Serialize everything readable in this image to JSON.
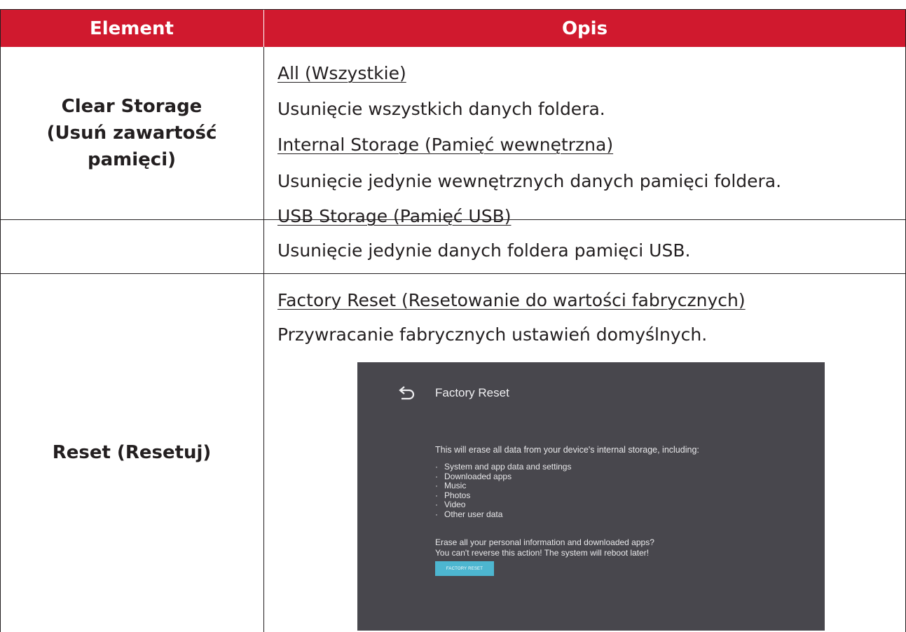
{
  "table": {
    "headers": {
      "element": "Element",
      "description": "Opis"
    },
    "rows": [
      {
        "element": "Clear Storage (Usuń zawartość pamięci)",
        "element_lines": [
          "Clear Storage",
          "(Usuń zawartość",
          "pamięci)"
        ],
        "items": [
          {
            "option": "All (Wszystkie)",
            "text": "Usunięcie wszystkich danych foldera."
          },
          {
            "option": "Internal Storage (Pamięć wewnętrzna)",
            "text": "Usunięcie jedynie wewnętrznych danych pamięci foldera."
          },
          {
            "option": "USB Storage (Pamięć USB)",
            "text": "Usunięcie jedynie danych foldera pamięci USB."
          }
        ]
      },
      {
        "element": "Reset (Resetuj)",
        "items": [
          {
            "option": "Factory Reset (Resetowanie do wartości fabrycznych)",
            "text": "Przywracanie fabrycznych ustawień domyślnych."
          }
        ]
      }
    ]
  },
  "screenshot": {
    "title": "Factory Reset",
    "intro": "This will erase all data from your device's internal storage, including:",
    "list": [
      "System and app data and settings",
      "Downloaded apps",
      "Music",
      "Photos",
      "Video",
      "Other user data"
    ],
    "warning_line1": "Erase all your personal information and downloaded apps?",
    "warning_line2": "You can't reverse this action! The system will reboot later!",
    "button": "FACTORY RESET",
    "back_icon": "back-arrow-icon",
    "colors": {
      "background": "#48474d",
      "button": "#4db6d0"
    }
  },
  "colors": {
    "header": "#d0192e",
    "text": "#231f20"
  }
}
